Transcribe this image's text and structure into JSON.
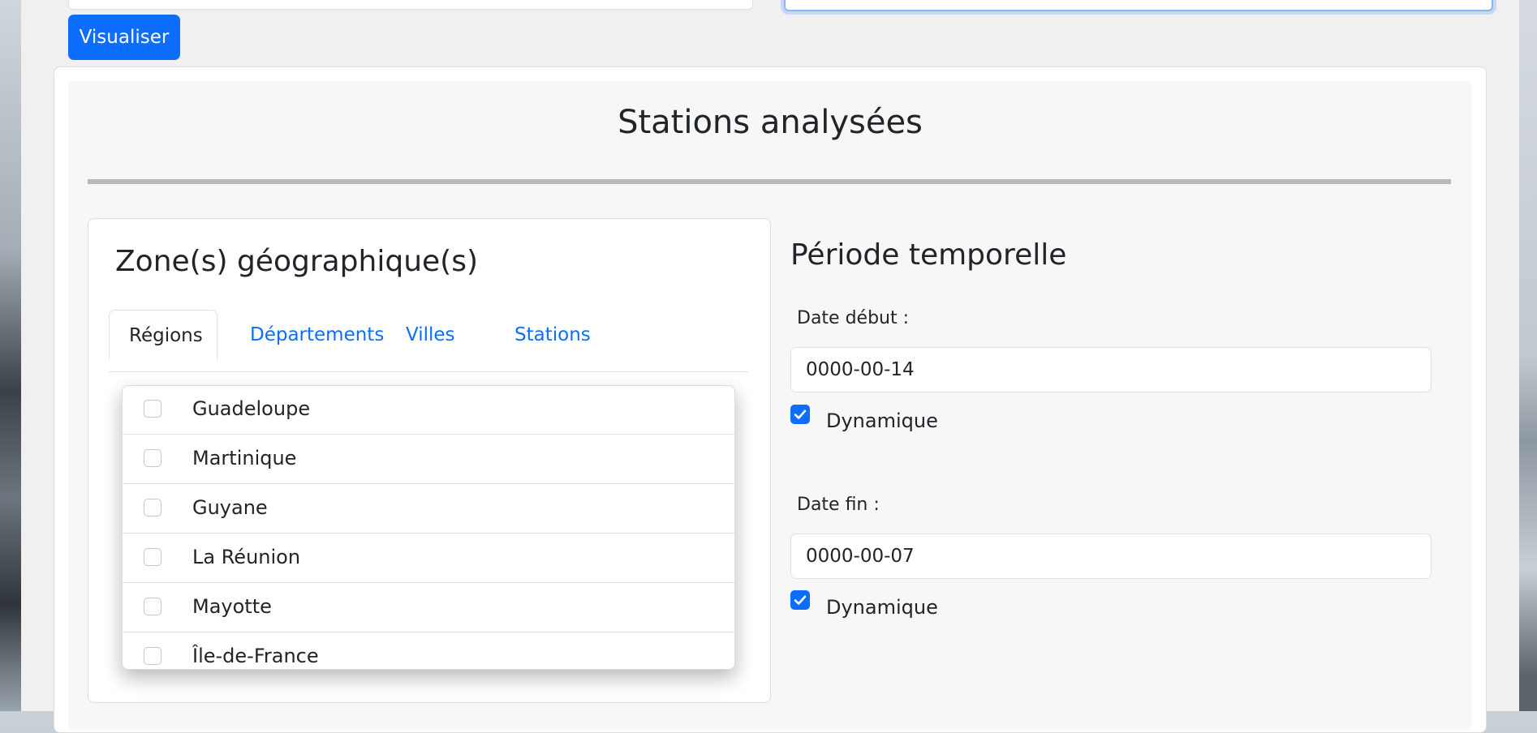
{
  "header": {
    "visualiser_label": "Visualiser"
  },
  "main": {
    "title": "Stations analysées"
  },
  "zone": {
    "title": "Zone(s) géographique(s)",
    "tabs": [
      {
        "label": "Régions",
        "active": true
      },
      {
        "label": "Départements",
        "active": false
      },
      {
        "label": "Villes",
        "active": false
      },
      {
        "label": "Stations",
        "active": false
      }
    ],
    "regions": [
      {
        "label": "Guadeloupe",
        "checked": false
      },
      {
        "label": "Martinique",
        "checked": false
      },
      {
        "label": "Guyane",
        "checked": false
      },
      {
        "label": "La Réunion",
        "checked": false
      },
      {
        "label": "Mayotte",
        "checked": false
      },
      {
        "label": "Île-de-France",
        "checked": false
      }
    ]
  },
  "periode": {
    "title": "Période temporelle",
    "date_debut": {
      "label": "Date début :",
      "value": "0000-00-14",
      "dynamique_label": "Dynamique",
      "dynamique_checked": true
    },
    "date_fin": {
      "label": "Date fin :",
      "value": "0000-00-07",
      "dynamique_label": "Dynamique",
      "dynamique_checked": true
    }
  },
  "colors": {
    "accent": "#0d6efd",
    "focus_border": "#86b7fe"
  }
}
